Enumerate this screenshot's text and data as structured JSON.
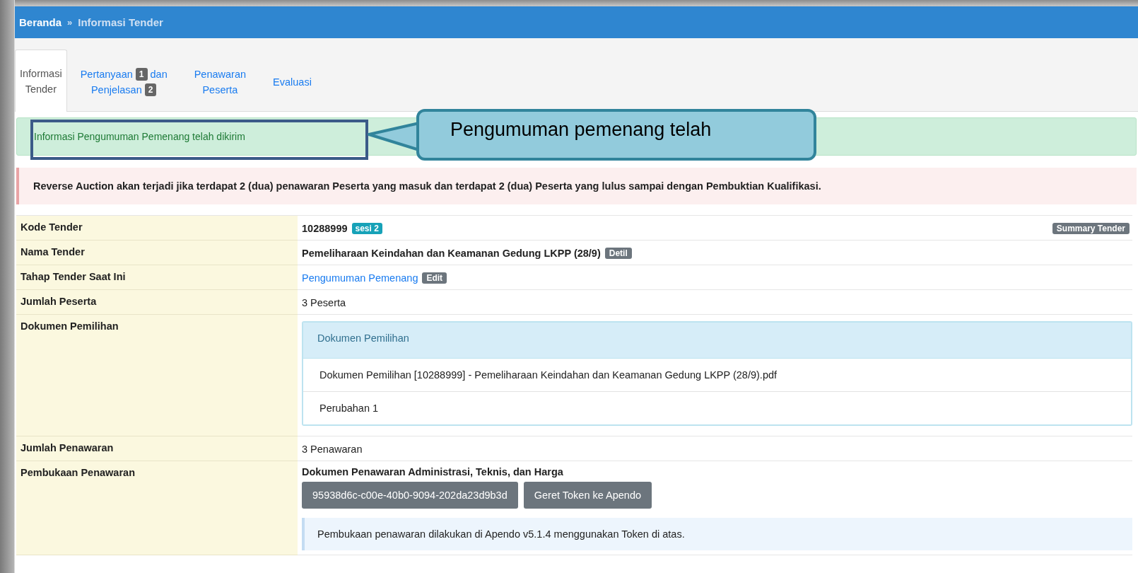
{
  "breadcrumb": {
    "items": [
      {
        "label": "Beranda",
        "kind": "link"
      },
      {
        "label": "Informasi Tender",
        "kind": "current"
      }
    ],
    "separator": "»"
  },
  "tabs": [
    {
      "selected": true,
      "lines": [
        [
          {
            "kind": "text",
            "text": "Informasi"
          }
        ],
        [
          {
            "kind": "text",
            "text": "Tender"
          }
        ]
      ]
    },
    {
      "selected": false,
      "lines": [
        [
          {
            "kind": "text",
            "text": "Pertanyaan"
          },
          {
            "kind": "badge",
            "text": "1"
          },
          {
            "kind": "text",
            "text": "dan"
          }
        ],
        [
          {
            "kind": "text",
            "text": "Penjelasan"
          },
          {
            "kind": "badge",
            "text": "2"
          }
        ]
      ]
    },
    {
      "selected": false,
      "lines": [
        [
          {
            "kind": "text",
            "text": "Penawaran"
          }
        ],
        [
          {
            "kind": "text",
            "text": "Peserta"
          }
        ]
      ]
    },
    {
      "selected": false,
      "lines": [
        [
          {
            "kind": "text",
            "text": "Evaluasi"
          }
        ]
      ]
    }
  ],
  "alerts": [
    {
      "kind": "success",
      "text": "Informasi Pengumuman Pemenang telah dikirim"
    },
    {
      "kind": "danger",
      "text": "Reverse Auction akan terjadi jika terdapat 2 (dua) penawaran Peserta yang masuk dan terdapat 2 (dua) Peserta yang lulus sampai dengan Pembuktian Kualifikasi."
    }
  ],
  "callout": {
    "text": "Pengumuman pemenang telah"
  },
  "details": [
    {
      "kind": "code",
      "label": "Kode Tender",
      "value": "10288999",
      "tag": "sesi 2",
      "right_button": "Summary Tender"
    },
    {
      "kind": "title",
      "label": "Nama Tender",
      "value": "Pemeliharaan Keindahan dan Keamanan Gedung LKPP (28/9)",
      "button": "Detil"
    },
    {
      "kind": "stage",
      "label": "Tahap Tender Saat Ini",
      "link": "Pengumuman Pemenang",
      "button": "Edit"
    },
    {
      "kind": "text",
      "label": "Jumlah Peserta",
      "value": "3 Peserta"
    },
    {
      "kind": "panel",
      "label": "Dokumen Pemilihan",
      "heading": "Dokumen Pemilihan",
      "items": [
        "Dokumen Pemilihan [10288999] - Pemeliharaan Keindahan dan Keamanan Gedung LKPP (28/9).pdf",
        "Perubahan 1"
      ]
    },
    {
      "kind": "text",
      "label": "Jumlah Penawaran",
      "value": "3 Penawaran"
    },
    {
      "kind": "opening",
      "label": "Pembukaan Penawaran",
      "heading": "Dokumen Penawaran Administrasi, Teknis, dan Harga",
      "buttons": [
        "95938d6c-c00e-40b0-9094-202da23d9b3d",
        "Geret Token ke Apendo"
      ],
      "note": "Pembukaan penawaran dilakukan di Apendo v5.1.4 menggunakan Token di atas."
    }
  ]
}
